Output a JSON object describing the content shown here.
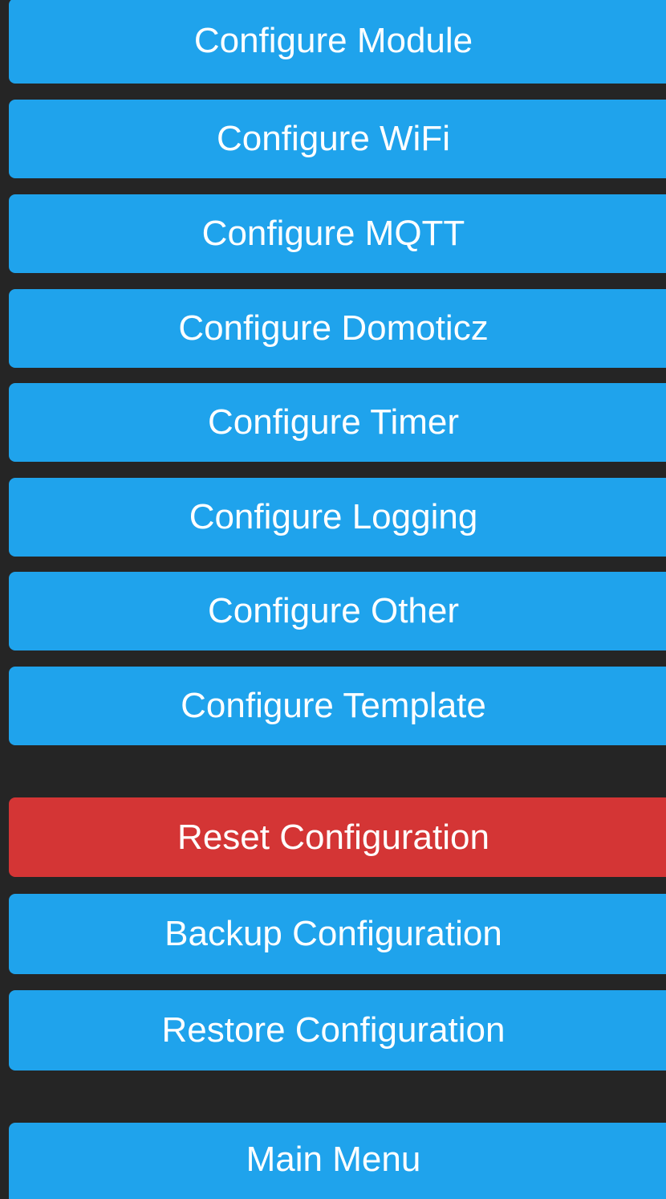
{
  "colors": {
    "background": "#252525",
    "button_primary": "#1fa3ec",
    "button_danger": "#d43535",
    "button_text": "#ffffff"
  },
  "configure_menu": {
    "module": "Configure Module",
    "wifi": "Configure WiFi",
    "mqtt": "Configure MQTT",
    "domoticz": "Configure Domoticz",
    "timer": "Configure Timer",
    "logging": "Configure Logging",
    "other": "Configure Other",
    "template": "Configure Template"
  },
  "config_actions": {
    "reset": "Reset Configuration",
    "backup": "Backup Configuration",
    "restore": "Restore Configuration"
  },
  "navigation": {
    "main_menu": "Main Menu"
  }
}
